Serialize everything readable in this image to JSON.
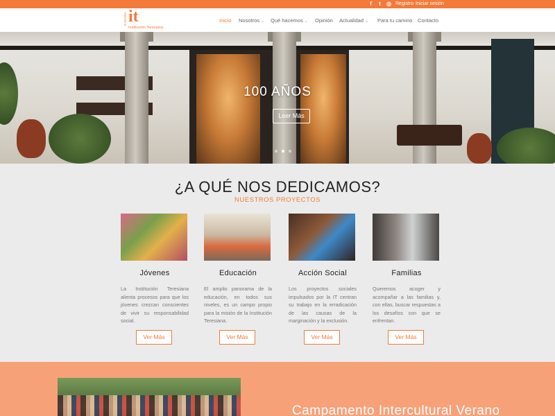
{
  "topbar": {
    "social": [
      {
        "icon": "facebook-icon",
        "glyph": "f"
      },
      {
        "icon": "twitter-icon",
        "glyph": "t"
      },
      {
        "icon": "rss-icon",
        "glyph": "◎"
      }
    ],
    "registro": "Registro",
    "iniciar": "Iniciar sesión"
  },
  "logo": {
    "espana": "ESPAÑA",
    "it": "it",
    "institucion": "Institución Teresiana"
  },
  "nav": {
    "inicio": "Inicio",
    "nosotros": "Nosotros",
    "que_hacemos": "Qué hacemos",
    "opinion": "Opinión",
    "actualidad": "Actualidad",
    "para_tu_camino": "Para tu camino",
    "contacto": "Contacto",
    "chevron": "⌄"
  },
  "hero": {
    "title": "100 AÑOS",
    "button": "Leer Más"
  },
  "section": {
    "title": "¿A QUÉ NOS DEDICAMOS?",
    "subtitle": "NUESTROS PROYECTOS",
    "cards": [
      {
        "title": "Jóvenes",
        "text": "La Institución Teresiana alienta procesos para que los jóvenes crezcan conscientes de vivir su responsabilidad social.",
        "button": "Ver Más"
      },
      {
        "title": "Educación",
        "text": "El amplio panorama de la educación, en todos sus niveles, es un campo propio para la misión de la Institución Teresiana.",
        "button": "Ver Más"
      },
      {
        "title": "Acción Social",
        "text": "Los proyectos sociales impulsados por la IT centran su trabajo en la erradicación de las causas de la marginación y la exclusión.",
        "button": "Ver Más"
      },
      {
        "title": "Familias",
        "text": "Queremos acoger y acompañar a las familias y, con ellas, buscar respuestas a los desafíos con que se enfrentan.",
        "button": "Ver Más"
      }
    ]
  },
  "bottom": {
    "title": "Campamento Intercultural Verano"
  },
  "colors": {
    "accent": "#f47a3a",
    "bottom_band": "#f7a179",
    "section_bg": "#ebebeb"
  }
}
